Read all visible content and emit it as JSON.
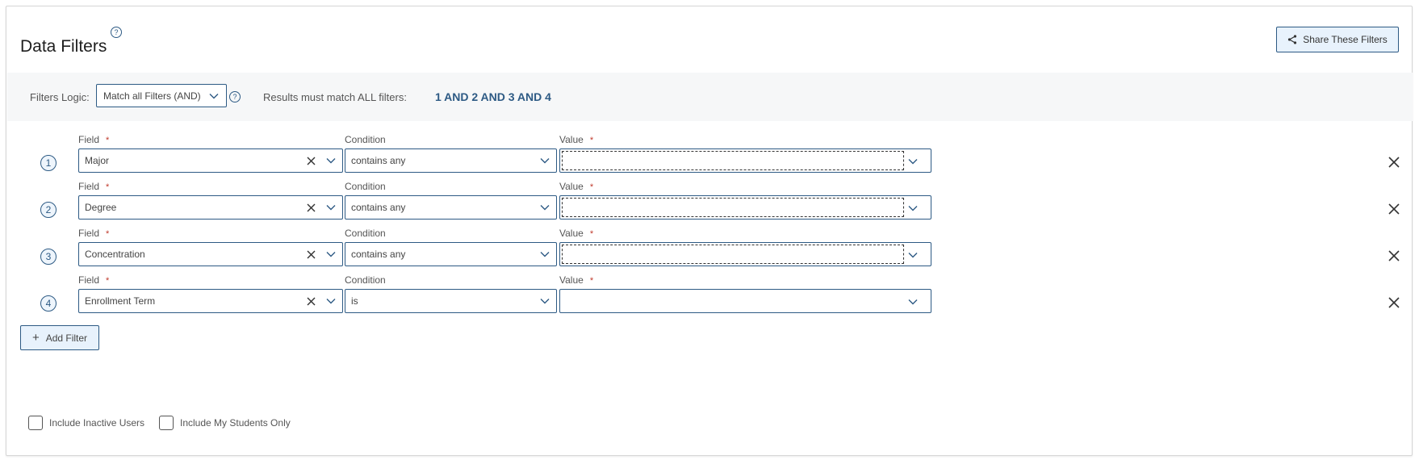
{
  "header": {
    "title": "Data Filters",
    "help_glyph": "?",
    "share_label": "Share These Filters"
  },
  "logic": {
    "label": "Filters Logic:",
    "selected": "Match all Filters (AND)",
    "help_glyph": "?",
    "results_text": "Results must match ALL filters:",
    "expression": "1 AND 2 AND 3 AND 4"
  },
  "labels": {
    "field": "Field",
    "condition": "Condition",
    "value": "Value",
    "required": "*"
  },
  "filters": [
    {
      "num": "1",
      "field": "Major",
      "condition": "contains any",
      "value": "",
      "value_focus": true
    },
    {
      "num": "2",
      "field": "Degree",
      "condition": "contains any",
      "value": "",
      "value_focus": true
    },
    {
      "num": "3",
      "field": "Concentration",
      "condition": "contains any",
      "value": "",
      "value_focus": true
    },
    {
      "num": "4",
      "field": "Enrollment Term",
      "condition": "is",
      "value": "",
      "value_focus": false
    }
  ],
  "actions": {
    "add_filter_label": "Add Filter",
    "add_glyph": "+"
  },
  "options": {
    "include_inactive": {
      "label": "Include Inactive Users",
      "checked": false
    },
    "my_students_only": {
      "label": "Include My Students Only",
      "checked": false
    }
  },
  "colors": {
    "accent": "#2d5a84",
    "button_bg": "#e8f2fc",
    "logic_bar_bg": "#f6f7f8",
    "required": "#c0392b"
  }
}
